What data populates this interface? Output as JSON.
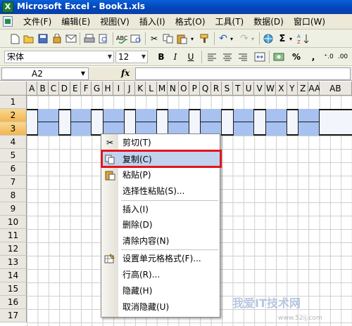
{
  "window": {
    "title": "Microsoft Excel - Book1.xls",
    "app_icon": "X"
  },
  "menubar": {
    "items": [
      "文件(F)",
      "编辑(E)",
      "视图(V)",
      "插入(I)",
      "格式(O)",
      "工具(T)",
      "数据(D)",
      "窗口(W)"
    ]
  },
  "format_toolbar": {
    "font_name": "宋体",
    "font_size": "12",
    "bold": "B",
    "italic": "I",
    "underline": "U",
    "percent": "%",
    "comma": ","
  },
  "formula_bar": {
    "name_box": "A2",
    "fx_label": "fx"
  },
  "sheet": {
    "columns": [
      "A",
      "B",
      "C",
      "D",
      "E",
      "F",
      "G",
      "H",
      "I",
      "J",
      "K",
      "L",
      "M",
      "N",
      "O",
      "P",
      "Q",
      "R",
      "S",
      "T",
      "U",
      "V",
      "W",
      "X",
      "Y",
      "Z",
      "AA",
      "AB"
    ],
    "rows": [
      "1",
      "2",
      "3",
      "4",
      "5",
      "6",
      "7",
      "8",
      "9",
      "10",
      "11",
      "12",
      "13",
      "14",
      "15",
      "16",
      "17"
    ],
    "selected_rows": [
      "2",
      "3"
    ]
  },
  "context_menu": {
    "items": [
      {
        "label": "剪切(T)",
        "icon": "scissors-icon"
      },
      {
        "label": "复制(C)",
        "icon": "copy-icon",
        "highlighted": true
      },
      {
        "label": "粘贴(P)",
        "icon": "paste-icon"
      },
      {
        "label": "选择性粘贴(S)...",
        "icon": ""
      },
      {
        "label": "插入(I)",
        "icon": ""
      },
      {
        "label": "删除(D)",
        "icon": ""
      },
      {
        "label": "清除内容(N)",
        "icon": ""
      },
      {
        "label": "设置单元格格式(F)...",
        "icon": "format-cells-icon"
      },
      {
        "label": "行高(R)...",
        "icon": ""
      },
      {
        "label": "隐藏(H)",
        "icon": ""
      },
      {
        "label": "取消隐藏(U)",
        "icon": ""
      }
    ]
  },
  "watermark": {
    "text": "我爱IT技术网",
    "url": "www.52ij.com"
  }
}
